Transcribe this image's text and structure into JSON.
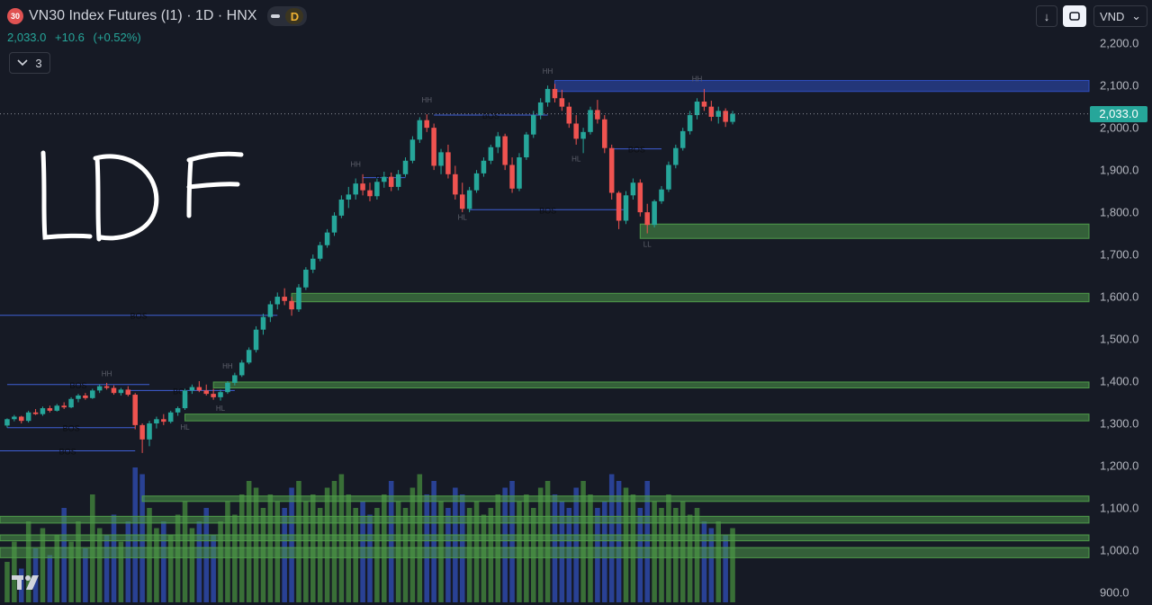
{
  "header": {
    "badge": "30",
    "title": "VN30 Index Futures (I1) · 1D · HNX",
    "interval_badge": "D",
    "last": "2,033.0",
    "change": "+10.6",
    "change_pct": "(+0.52%)",
    "indicator_count": "3"
  },
  "toolbar": {
    "currency": "VND",
    "currency_caret": "⌄",
    "download_glyph": "↓",
    "fit_glyph": "⬚"
  },
  "colors": {
    "background": "#161a25",
    "up": "#26a69a",
    "down": "#ef5350",
    "supply": "#2f4ec0",
    "demand": "#4f9b4a",
    "bos_line": "#3f5fd6"
  },
  "chart_data": {
    "type": "candlestick",
    "title": "VN30 Index Futures (I1) · 1D · HNX",
    "xlabel": "",
    "ylabel": "",
    "ylim": [
      870,
      2260
    ],
    "yticks": [
      "2,200.0",
      "2,100.0",
      "2,000.0",
      "1,900.0",
      "1,800.0",
      "1,700.0",
      "1,600.0",
      "1,500.0",
      "1,400.0",
      "1,300.0",
      "1,200.0",
      "1,100.0",
      "1,000.0",
      "900.0"
    ],
    "ytick_values": [
      2200,
      2100,
      2000,
      1900,
      1800,
      1700,
      1600,
      1500,
      1400,
      1300,
      1200,
      1100,
      1000,
      900
    ],
    "last_price": 2033.0,
    "last_price_label": "2,033.0",
    "candles": [
      [
        1295,
        1312,
        1290,
        1310
      ],
      [
        1310,
        1320,
        1305,
        1316
      ],
      [
        1316,
        1318,
        1300,
        1306
      ],
      [
        1306,
        1330,
        1302,
        1326
      ],
      [
        1326,
        1334,
        1320,
        1322
      ],
      [
        1322,
        1340,
        1318,
        1336
      ],
      [
        1336,
        1342,
        1326,
        1330
      ],
      [
        1330,
        1346,
        1328,
        1342
      ],
      [
        1342,
        1350,
        1334,
        1338
      ],
      [
        1338,
        1362,
        1336,
        1358
      ],
      [
        1358,
        1370,
        1350,
        1366
      ],
      [
        1366,
        1372,
        1356,
        1360
      ],
      [
        1360,
        1382,
        1358,
        1378
      ],
      [
        1378,
        1392,
        1372,
        1388
      ],
      [
        1388,
        1396,
        1380,
        1384
      ],
      [
        1384,
        1390,
        1368,
        1372
      ],
      [
        1372,
        1384,
        1366,
        1380
      ],
      [
        1380,
        1388,
        1364,
        1368
      ],
      [
        1368,
        1372,
        1286,
        1296
      ],
      [
        1296,
        1300,
        1230,
        1262
      ],
      [
        1262,
        1306,
        1246,
        1300
      ],
      [
        1300,
        1316,
        1288,
        1310
      ],
      [
        1310,
        1322,
        1296,
        1304
      ],
      [
        1304,
        1330,
        1300,
        1326
      ],
      [
        1326,
        1340,
        1318,
        1336
      ],
      [
        1336,
        1382,
        1332,
        1378
      ],
      [
        1378,
        1392,
        1370,
        1386
      ],
      [
        1386,
        1400,
        1374,
        1378
      ],
      [
        1378,
        1392,
        1366,
        1370
      ],
      [
        1370,
        1382,
        1356,
        1362
      ],
      [
        1362,
        1380,
        1354,
        1374
      ],
      [
        1374,
        1400,
        1370,
        1396
      ],
      [
        1396,
        1420,
        1390,
        1414
      ],
      [
        1414,
        1450,
        1410,
        1444
      ],
      [
        1444,
        1480,
        1440,
        1474
      ],
      [
        1474,
        1530,
        1468,
        1522
      ],
      [
        1522,
        1560,
        1510,
        1552
      ],
      [
        1552,
        1590,
        1540,
        1582
      ],
      [
        1582,
        1610,
        1570,
        1600
      ],
      [
        1600,
        1620,
        1580,
        1590
      ],
      [
        1590,
        1600,
        1555,
        1570
      ],
      [
        1570,
        1630,
        1564,
        1622
      ],
      [
        1622,
        1670,
        1616,
        1664
      ],
      [
        1664,
        1700,
        1656,
        1690
      ],
      [
        1690,
        1730,
        1684,
        1722
      ],
      [
        1722,
        1760,
        1716,
        1752
      ],
      [
        1752,
        1800,
        1744,
        1792
      ],
      [
        1792,
        1840,
        1786,
        1830
      ],
      [
        1830,
        1860,
        1810,
        1842
      ],
      [
        1842,
        1880,
        1830,
        1868
      ],
      [
        1868,
        1890,
        1840,
        1852
      ],
      [
        1852,
        1870,
        1826,
        1838
      ],
      [
        1838,
        1880,
        1830,
        1872
      ],
      [
        1872,
        1896,
        1858,
        1884
      ],
      [
        1884,
        1894,
        1850,
        1860
      ],
      [
        1860,
        1900,
        1852,
        1890
      ],
      [
        1890,
        1930,
        1884,
        1922
      ],
      [
        1922,
        1980,
        1916,
        1972
      ],
      [
        1972,
        2025,
        1964,
        2018
      ],
      [
        2018,
        2032,
        1990,
        2000
      ],
      [
        2000,
        2010,
        1900,
        1910
      ],
      [
        1910,
        1950,
        1890,
        1942
      ],
      [
        1942,
        1960,
        1880,
        1890
      ],
      [
        1890,
        1910,
        1830,
        1842
      ],
      [
        1842,
        1870,
        1800,
        1808
      ],
      [
        1808,
        1860,
        1800,
        1852
      ],
      [
        1852,
        1900,
        1846,
        1892
      ],
      [
        1892,
        1930,
        1884,
        1922
      ],
      [
        1922,
        1960,
        1914,
        1954
      ],
      [
        1954,
        1990,
        1940,
        1980
      ],
      [
        1980,
        1986,
        1900,
        1912
      ],
      [
        1912,
        1930,
        1846,
        1856
      ],
      [
        1856,
        1940,
        1850,
        1930
      ],
      [
        1930,
        1990,
        1924,
        1984
      ],
      [
        1984,
        2040,
        1976,
        2030
      ],
      [
        2030,
        2070,
        2020,
        2060
      ],
      [
        2060,
        2100,
        2050,
        2092
      ],
      [
        2092,
        2104,
        2060,
        2070
      ],
      [
        2070,
        2090,
        2040,
        2050
      ],
      [
        2050,
        2060,
        2000,
        2010
      ],
      [
        2010,
        2030,
        1960,
        1974
      ],
      [
        1974,
        2000,
        1940,
        1990
      ],
      [
        1990,
        2050,
        1984,
        2042
      ],
      [
        2042,
        2066,
        2010,
        2020
      ],
      [
        2020,
        2030,
        1940,
        1952
      ],
      [
        1952,
        1960,
        1830,
        1846
      ],
      [
        1846,
        1850,
        1760,
        1780
      ],
      [
        1780,
        1850,
        1772,
        1840
      ],
      [
        1840,
        1880,
        1830,
        1870
      ],
      [
        1870,
        1878,
        1790,
        1800
      ],
      [
        1800,
        1820,
        1750,
        1770
      ],
      [
        1770,
        1830,
        1764,
        1826
      ],
      [
        1826,
        1862,
        1820,
        1854
      ],
      [
        1854,
        1920,
        1848,
        1912
      ],
      [
        1912,
        1960,
        1904,
        1952
      ],
      [
        1952,
        2000,
        1946,
        1992
      ],
      [
        1992,
        2040,
        1984,
        2030
      ],
      [
        2030,
        2070,
        2020,
        2062
      ],
      [
        2062,
        2092,
        2040,
        2050
      ],
      [
        2050,
        2064,
        2016,
        2026
      ],
      [
        2026,
        2050,
        2010,
        2040
      ],
      [
        2040,
        2046,
        2002,
        2014
      ],
      [
        2014,
        2040,
        2008,
        2033
      ]
    ],
    "volume_relative": [
      0.3,
      0.45,
      0.25,
      0.6,
      0.4,
      0.55,
      0.35,
      0.5,
      0.7,
      0.45,
      0.6,
      0.4,
      0.8,
      0.55,
      0.5,
      0.65,
      0.45,
      0.6,
      1.0,
      0.95,
      0.7,
      0.55,
      0.6,
      0.5,
      0.65,
      0.75,
      0.55,
      0.6,
      0.7,
      0.5,
      0.6,
      0.75,
      0.65,
      0.8,
      0.9,
      0.85,
      0.7,
      0.8,
      0.75,
      0.7,
      0.85,
      0.9,
      0.75,
      0.8,
      0.7,
      0.85,
      0.9,
      0.95,
      0.8,
      0.7,
      0.75,
      0.65,
      0.7,
      0.8,
      0.9,
      0.75,
      0.7,
      0.85,
      0.95,
      0.8,
      0.9,
      0.75,
      0.7,
      0.85,
      0.8,
      0.7,
      0.75,
      0.65,
      0.7,
      0.8,
      0.85,
      0.9,
      0.75,
      0.8,
      0.7,
      0.85,
      0.9,
      0.8,
      0.75,
      0.7,
      0.85,
      0.9,
      0.8,
      0.7,
      0.75,
      0.95,
      0.9,
      0.85,
      0.8,
      0.7,
      0.9,
      0.75,
      0.7,
      0.8,
      0.7,
      0.75,
      0.65,
      0.7,
      0.6,
      0.55,
      0.6,
      0.5,
      0.55
    ]
  },
  "zones": [
    {
      "kind": "supply",
      "top": 2112,
      "bottom": 2086,
      "from_candle": 77
    },
    {
      "kind": "demand",
      "top": 1772,
      "bottom": 1738,
      "from_candle": 89
    },
    {
      "kind": "demand",
      "top": 1608,
      "bottom": 1588,
      "from_candle": 40
    },
    {
      "kind": "demand",
      "top": 1398,
      "bottom": 1384,
      "from_candle": 29
    },
    {
      "kind": "demand",
      "top": 1322,
      "bottom": 1306,
      "from_candle": 25
    },
    {
      "kind": "demand",
      "top": 1128,
      "bottom": 1116,
      "from_candle": 19
    },
    {
      "kind": "demand",
      "top": 1080,
      "bottom": 1064,
      "from_candle": -1
    },
    {
      "kind": "demand",
      "top": 1036,
      "bottom": 1022,
      "from_candle": -1
    },
    {
      "kind": "demand",
      "top": 1006,
      "bottom": 982,
      "from_candle": -1
    }
  ],
  "structure_lines": [
    {
      "price": 2030,
      "from": 60,
      "to": 76,
      "label": "BOS"
    },
    {
      "price": 1882,
      "from": 50,
      "to": 56,
      "label": "BOS"
    },
    {
      "price": 1806,
      "from": 65,
      "to": 87,
      "label": "BOS"
    },
    {
      "price": 1950,
      "from": 85,
      "to": 92,
      "label": "BOS"
    },
    {
      "price": 1556,
      "from": -1,
      "to": 38,
      "label": "BOS"
    },
    {
      "price": 1392,
      "from": 0,
      "to": 20,
      "label": "BOS"
    },
    {
      "price": 1378,
      "from": 17,
      "to": 32,
      "label": "BOS"
    },
    {
      "price": 1290,
      "from": 0,
      "to": 18,
      "label": "BOS"
    },
    {
      "price": 1235,
      "from": -1,
      "to": 18,
      "label": "BOS"
    }
  ],
  "swing_labels": [
    {
      "text": "HH",
      "candle": 76,
      "price": 2128
    },
    {
      "text": "HH",
      "candle": 97,
      "price": 2110
    },
    {
      "text": "HH",
      "candle": 59,
      "price": 2060
    },
    {
      "text": "HH",
      "candle": 49,
      "price": 1908
    },
    {
      "text": "HH",
      "candle": 14,
      "price": 1412
    },
    {
      "text": "HH",
      "candle": 31,
      "price": 1430
    },
    {
      "text": "HL",
      "candle": 64,
      "price": 1782
    },
    {
      "text": "HL",
      "candle": 80,
      "price": 1920
    },
    {
      "text": "HL",
      "candle": 30,
      "price": 1330
    },
    {
      "text": "HL",
      "candle": 25,
      "price": 1285
    },
    {
      "text": "LL",
      "candle": 90,
      "price": 1718
    }
  ],
  "annotation": "LDF"
}
